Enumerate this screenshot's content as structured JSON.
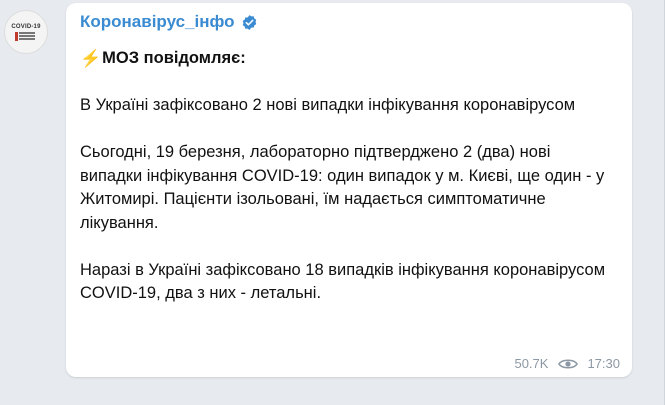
{
  "channel": {
    "name": "Коронавірус_інфо",
    "avatar_text": "COVID-19",
    "verified_icon": "verified-badge-icon",
    "accent_color": "#3a8bd1"
  },
  "message": {
    "bolt_icon": "⚡",
    "heading": "МОЗ повідомляє:",
    "paragraph_1": "В Україні зафіксовано 2 нові випадки інфікування коронавірусом",
    "paragraph_2": "Сьогодні, 19 березня, лабораторно підтверджено 2 (два) нові випадки інфікування COVID-19: один випадок у м. Києві, ще один - у Житомирі. Пацієнти ізольовані, їм надається симптоматичне лікування.",
    "paragraph_3": "Наразі в Україні зафіксовано 18 випадків інфікування коронавірусом COVID-19, два з них - летальні."
  },
  "meta": {
    "views": "50.7K",
    "time": "17:30",
    "views_icon": "eye-icon"
  }
}
